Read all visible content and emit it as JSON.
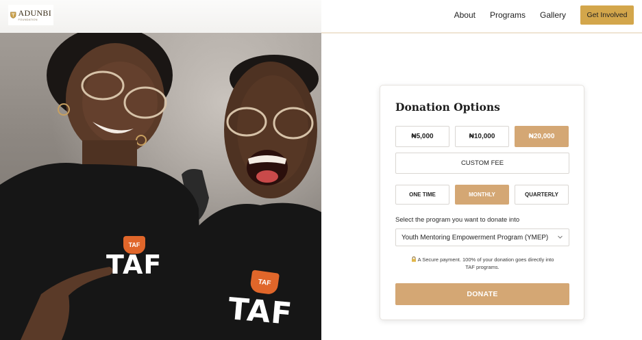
{
  "header": {
    "logo_text": "ADUNBI",
    "logo_sub": "FOUNDATION",
    "nav": [
      {
        "label": "About"
      },
      {
        "label": "Programs"
      },
      {
        "label": "Gallery"
      }
    ],
    "cta_label": "Get Involved"
  },
  "hero_photo": {
    "shirt_text_left": "TAF",
    "shirt_text_right": "TAF",
    "badge_text": "TAF"
  },
  "donation": {
    "title": "Donation Options",
    "amounts": [
      {
        "label": "₦5,000",
        "selected": false
      },
      {
        "label": "₦10,000",
        "selected": false
      },
      {
        "label": "₦20,000",
        "selected": true
      }
    ],
    "custom_label": "CUSTOM FEE",
    "frequencies": [
      {
        "label": "ONE TIME",
        "selected": false
      },
      {
        "label": "MONTHLY",
        "selected": true
      },
      {
        "label": "QUARTERLY",
        "selected": false
      }
    ],
    "program_prompt": "Select the program you want to donate into",
    "program_selected": "Youth Mentoring Empowerment Program (YMEP)",
    "secure_line1": "A Secure payment. 100% of your donation goes directly into",
    "secure_line2": "TAF programs.",
    "donate_label": "DONATE"
  },
  "colors": {
    "accent_gold": "#d3a64b",
    "selected_tan": "#d4a774",
    "shirt_black": "#161616",
    "badge_orange": "#e0662a"
  }
}
